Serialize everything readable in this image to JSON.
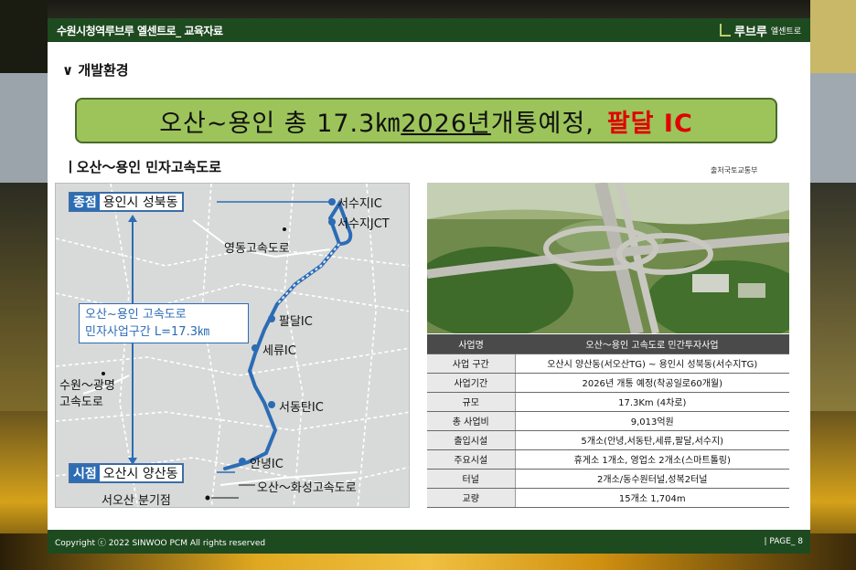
{
  "header": {
    "title": "수원시청역루브루 엘센트로_ 교육자료",
    "brand_name": "루브루",
    "brand_sub": "엘센트로"
  },
  "section_heading": "∨ 개발환경",
  "banner": {
    "part1": "오산~용인 총 17.3㎞ ",
    "part2": "2026년",
    "part3": " 개통예정,",
    "part4": "팔달 IC"
  },
  "sub_heading": "ㅣ오산～용인 민자고속도로",
  "source": "출처국토교통부",
  "map": {
    "end_tag": "종점",
    "end_text": "용인시 성북동",
    "start_tag": "시점",
    "start_text": "오산시 양산동",
    "legend_line1": "오산~용인 고속도로",
    "legend_line2": "민자사업구간 L=17.3㎞",
    "labels": {
      "seosuji_ic": "서수지IC",
      "seosuji_jct": "서수지JCT",
      "yeongdong": "영동고속도로",
      "paldal": "팔달IC",
      "seryu": "세류IC",
      "sudong": "서동탄IC",
      "anyeong": "안녕IC",
      "suwon1": "수원～광명",
      "suwon2": "고속도로",
      "osan_hwaseong": "오산～화성고속도로",
      "seoosan": "서오산 분기점"
    }
  },
  "table": {
    "header": [
      "사업명",
      "오산～용인 고속도로 민간투자사업"
    ],
    "rows": [
      [
        "사업 구간",
        "오산시 양산동(서오산TG) ~ 용인시 성북동(서수지TG)"
      ],
      [
        "사업기간",
        "2026년 개통 예정(착공일로60개월)"
      ],
      [
        "규모",
        "17.3Km (4차로)"
      ],
      [
        "총 사업비",
        "9,013억원"
      ],
      [
        "출입시설",
        "5개소(안녕,서동탄,세류,팔달,서수지)"
      ],
      [
        "주요시설",
        "휴게소 1개소, 영업소 2개소(스마트톨링)"
      ],
      [
        "터널",
        "2개소/동수원터널,성복2터널"
      ],
      [
        "교량",
        "15개소 1,704m"
      ]
    ]
  },
  "footer": {
    "copyright": "Copyright ⓒ 2022 SINWOO PCM All rights reserved",
    "page": "|  PAGE_  8"
  },
  "colors": {
    "dark_green": "#1e4a20",
    "banner_green": "#9cc45a",
    "route_blue": "#2c6cb4",
    "highlight_red": "#e00000"
  }
}
